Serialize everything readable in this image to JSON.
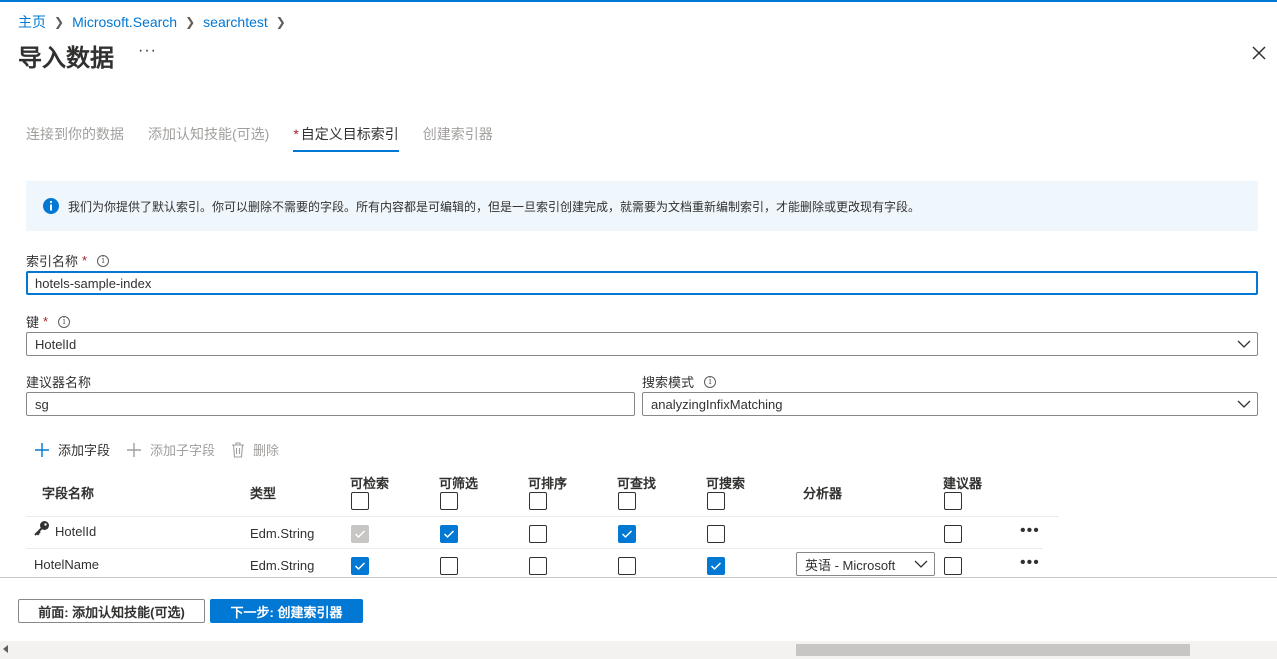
{
  "breadcrumb": {
    "home": "主页",
    "service": "Microsoft.Search",
    "resource": "searchtest"
  },
  "page": {
    "title": "导入数据",
    "more": "···"
  },
  "wizard_tabs": [
    {
      "label": "连接到你的数据",
      "required": false,
      "active": false
    },
    {
      "label": "添加认知技能(可选)",
      "required": false,
      "active": false
    },
    {
      "label": "自定义目标索引",
      "required": true,
      "active": true
    },
    {
      "label": "创建索引器",
      "required": false,
      "active": false
    }
  ],
  "required_mark": "*",
  "info": {
    "text": "我们为你提供了默认索引。你可以删除不需要的字段。所有内容都是可编辑的，但是一旦索引创建完成，就需要为文档重新编制索引，才能删除或更改现有字段。"
  },
  "form": {
    "index_name_label": "索引名称",
    "index_name_value": "hotels-sample-index",
    "key_label": "键",
    "key_value": "HotelId",
    "suggester_label": "建议器名称",
    "suggester_value": "sg",
    "search_mode_label": "搜索模式",
    "search_mode_value": "analyzingInfixMatching",
    "hint_glyph": "i"
  },
  "toolbar": {
    "add_field": "添加字段",
    "add_subfield": "添加子字段",
    "delete": "删除"
  },
  "columns": {
    "field_name": "字段名称",
    "type": "类型",
    "retrievable": "可检索",
    "filterable": "可筛选",
    "sortable": "可排序",
    "facetable": "可查找",
    "searchable": "可搜索",
    "analyzer": "分析器",
    "suggester": "建议器"
  },
  "rows": [
    {
      "name": "HotelId",
      "type": "Edm.String",
      "key": true,
      "retrievable": "disabled-checked",
      "filterable": true,
      "sortable": false,
      "facetable": true,
      "searchable": false,
      "analyzer": "",
      "suggester": false,
      "more": "•••"
    },
    {
      "name": "HotelName",
      "type": "Edm.String",
      "key": false,
      "retrievable": true,
      "filterable": false,
      "sortable": false,
      "facetable": false,
      "searchable": true,
      "analyzer": "英语 - Microsoft",
      "suggester": false,
      "more": "•••"
    }
  ],
  "footer": {
    "prev": "前面: 添加认知技能(可选)",
    "next": "下一步: 创建索引器"
  },
  "colors": {
    "accent": "#0078d4",
    "required": "#a4262c",
    "info_bg": "#eff6fc"
  }
}
